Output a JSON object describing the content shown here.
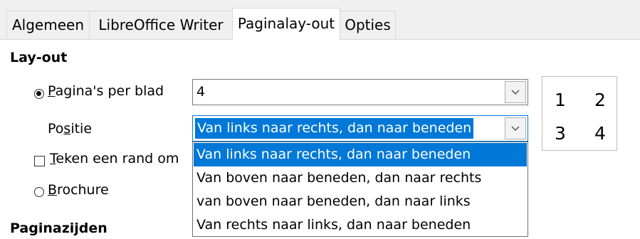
{
  "tabs": [
    {
      "label": "Algemeen",
      "active": false
    },
    {
      "label": "LibreOffice Writer",
      "active": false
    },
    {
      "label": "Paginalay-out",
      "active": true
    },
    {
      "label": "Opties",
      "active": false
    }
  ],
  "layout": {
    "heading": "Lay-out",
    "pages_per_sheet": {
      "label_underlined": "P",
      "label_rest": "agina's per blad",
      "selected": true,
      "value": "4"
    },
    "position": {
      "label_before": "Po",
      "label_underlined": "s",
      "label_after": "itie",
      "value": "Van links naar rechts, dan naar beneden",
      "options": [
        "Van links naar rechts, dan naar beneden",
        "Van boven naar beneden, dan naar rechts",
        "van boven naar beneden, dan naar links",
        "Van rechts naar links, dan naar beneden"
      ]
    },
    "draw_border": {
      "label_underlined": "T",
      "label_rest": "eken een rand om",
      "checked": false
    },
    "brochure": {
      "label_underlined": "B",
      "label_rest": "rochure",
      "selected": false
    },
    "preview_numbers": [
      "1",
      "2",
      "3",
      "4"
    ]
  },
  "page_sides": {
    "heading": "Paginazijden"
  },
  "colors": {
    "accent": "#0078d7",
    "tab_bar": "#f0f0f0"
  }
}
